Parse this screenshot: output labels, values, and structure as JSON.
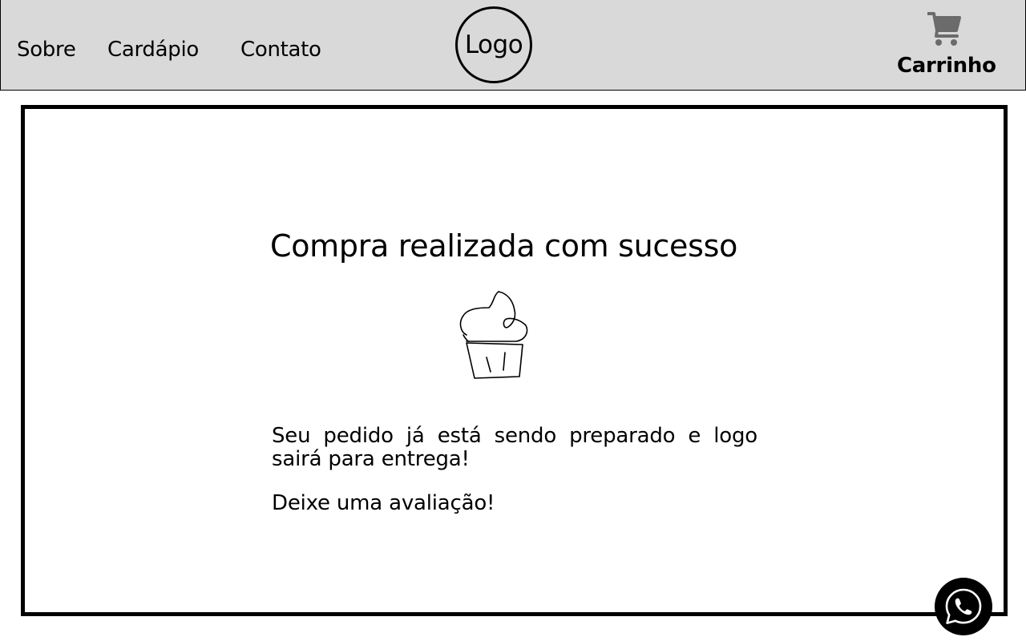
{
  "header": {
    "nav": {
      "sobre": "Sobre",
      "cardapio": "Cardápio",
      "contato": "Contato"
    },
    "logo_text": "Logo",
    "cart": {
      "label": "Carrinho",
      "icon": "shopping-cart-icon"
    },
    "background_color": "#d9d9d9"
  },
  "main": {
    "title": "Compra realizada com sucesso",
    "illustration": "cupcake-icon",
    "message": "Seu pedido já está sendo preparado e logo sairá para entrega!",
    "review_text": "Deixe uma avaliação!"
  },
  "floating": {
    "whatsapp_icon": "whatsapp-icon"
  }
}
